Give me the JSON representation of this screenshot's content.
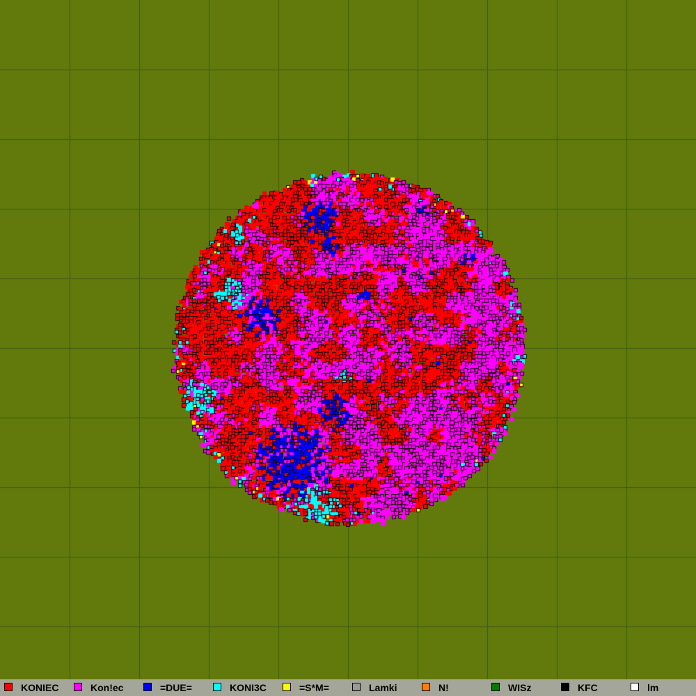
{
  "map": {
    "background": "#627a0c",
    "grid_color": "#3d5a10"
  },
  "legend": [
    {
      "name": "KONIEC",
      "color": "#ff0000"
    },
    {
      "name": "Kon!ec",
      "color": "#ff00ff"
    },
    {
      "name": "=DUE=",
      "color": "#0000ff"
    },
    {
      "name": "KONI3C",
      "color": "#00ffff"
    },
    {
      "name": "=S*M=",
      "color": "#ffff00"
    },
    {
      "name": "Lamki",
      "color": "#999999"
    },
    {
      "name": "N!",
      "color": "#ff8000"
    },
    {
      "name": "WISz",
      "color": "#007a00"
    },
    {
      "name": "KFC",
      "color": "#000000"
    },
    {
      "name": "lm",
      "color": "#ffffff"
    }
  ]
}
